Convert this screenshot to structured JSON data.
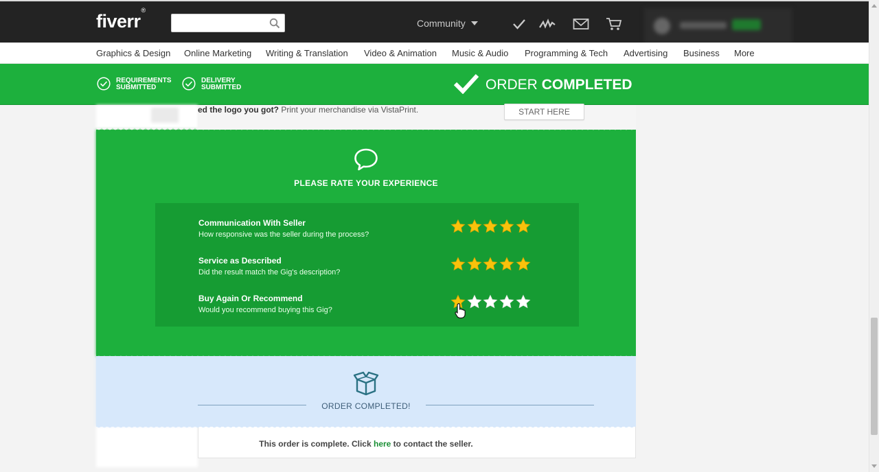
{
  "header": {
    "logo": "fiverr",
    "logo_mark": "®",
    "search": {
      "value": "",
      "placeholder": ""
    },
    "community_label": "Community",
    "icons": [
      "checkmark-icon",
      "activity-icon",
      "mail-icon",
      "cart-icon"
    ]
  },
  "categories": [
    "Graphics & Design",
    "Online Marketing",
    "Writing & Translation",
    "Video & Animation",
    "Music & Audio",
    "Programming & Tech",
    "Advertising",
    "Business",
    "More"
  ],
  "progress": {
    "steps": [
      {
        "line1": "REQUIREMENTS",
        "line2": "SUBMITTED"
      },
      {
        "line1": "DELIVERY",
        "line2": "SUBMITTED"
      }
    ],
    "status_light": "ORDER",
    "status_bold": "COMPLETED"
  },
  "vistaprint": {
    "bold_text": "ed the logo you got?",
    "text": " Print your merchandise via VistaPrint.",
    "button": "START HERE"
  },
  "rating": {
    "title": "PLEASE RATE YOUR EXPERIENCE",
    "criteria": [
      {
        "title": "Communication With Seller",
        "desc": "How responsive was the seller during the process?",
        "stars": 5,
        "max": 5
      },
      {
        "title": "Service as Described",
        "desc": "Did the result match the Gig's description?",
        "stars": 5,
        "max": 5
      },
      {
        "title": "Buy Again Or Recommend",
        "desc": "Would you recommend buying this Gig?",
        "stars": 1,
        "max": 5
      }
    ]
  },
  "completed": {
    "label": "ORDER COMPLETED!",
    "note_before": "This order is complete. Click ",
    "note_link": "here",
    "note_after": " to contact the seller."
  },
  "colors": {
    "fiverr_green": "#1db03d",
    "dark_green": "#169c33",
    "header_bg": "#232323",
    "completed_bg": "#d7e8fb",
    "star_gold": "#f9c20c"
  }
}
